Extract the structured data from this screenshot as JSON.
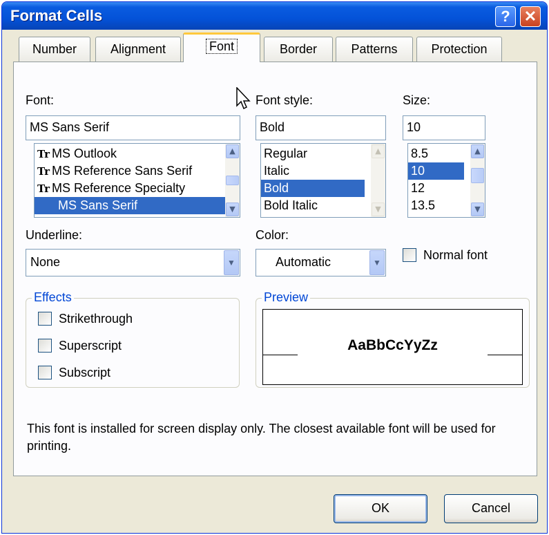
{
  "window": {
    "title": "Format Cells",
    "help_glyph": "?",
    "close_glyph": "✕"
  },
  "tabs": [
    {
      "label": "Number"
    },
    {
      "label": "Alignment"
    },
    {
      "label": "Font",
      "active": true
    },
    {
      "label": "Border"
    },
    {
      "label": "Patterns"
    },
    {
      "label": "Protection"
    }
  ],
  "font": {
    "label": "Font:",
    "value": "MS Sans Serif",
    "items": [
      "MS Outlook",
      "MS Reference Sans Serif",
      "MS Reference Specialty",
      "MS Sans Serif"
    ],
    "item_icon": "Tr",
    "selected_index": 3
  },
  "font_style": {
    "label": "Font style:",
    "value": "Bold",
    "items": [
      "Regular",
      "Italic",
      "Bold",
      "Bold Italic"
    ],
    "selected_index": 2
  },
  "size": {
    "label": "Size:",
    "value": "10",
    "items": [
      "8.5",
      "10",
      "12",
      "13.5"
    ],
    "selected_index": 1
  },
  "underline": {
    "label": "Underline:",
    "value": "None"
  },
  "color": {
    "label": "Color:",
    "value": "Automatic"
  },
  "normal_font": {
    "label": "Normal font",
    "checked": false
  },
  "effects": {
    "title": "Effects",
    "strikethrough": "Strikethrough",
    "superscript": "Superscript",
    "subscript": "Subscript"
  },
  "preview": {
    "title": "Preview",
    "sample": "AaBbCcYyZz"
  },
  "note": "This font is installed for screen display only.  The closest available font will be used for printing.",
  "buttons": {
    "ok": "OK",
    "cancel": "Cancel"
  },
  "colors": {
    "accent": "#316ac5",
    "titlebar": "#0452d8",
    "group_title": "#0046d5",
    "dialog_bg": "#ece9d8"
  }
}
